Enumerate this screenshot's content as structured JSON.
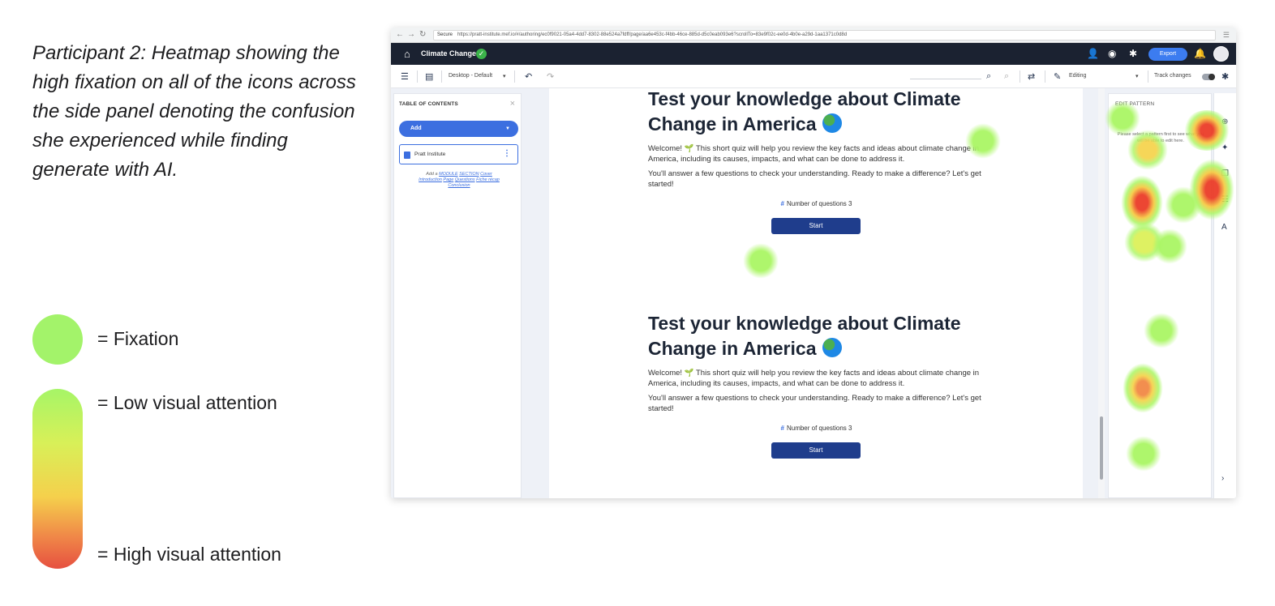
{
  "caption": "Participant 2: Heatmap showing the high fixation on all of the icons across the side panel denoting the confusion she experienced while finding generate with AI.",
  "legend": {
    "fixation": "= Fixation",
    "low": "= Low visual attention",
    "high": "= High visual attention",
    "colors": {
      "fixation": "#a3f36a",
      "low": "#a6f567",
      "mid": "#f5d04c",
      "high": "#e65040"
    }
  },
  "browser": {
    "secure_label": "Secure",
    "url": "https://pratt-institute.mef.io/#/authoring/ec0f9021-05a4-4dd7-8302-88e524a7fdff/page/aa6e453c-f4bb-46ce-885d-d5c0eab093e6?scrollTo=83e9f02c-ee0d-4b0e-a29d-1aa1371c0d8d"
  },
  "app": {
    "title": "Climate Change",
    "export_label": "Export",
    "icons": [
      "home-icon",
      "check-icon",
      "add-user-icon",
      "eye-icon",
      "gear-icon",
      "bell-icon"
    ]
  },
  "toolbar": {
    "device": "Desktop - Default",
    "mode": "Editing",
    "track_changes": "Track changes"
  },
  "toc": {
    "heading": "TABLE OF CONTENTS",
    "add_label": "Add",
    "item_label": "Pratt Institute",
    "links": [
      "Add a",
      "MODULE",
      "SECTION",
      "Cover",
      "Introduction",
      "Page",
      "Questions",
      "Fiche récap",
      "Conclusion"
    ]
  },
  "quiz": {
    "title": "Test your knowledge about Climate Change in America",
    "welcome": "Welcome! 🌱 This short quiz will help you review the key facts and ideas about climate change in America, including its causes, impacts, and what can be done to address it.",
    "answer": "You'll answer a few questions to check your understanding. Ready to make a difference? Let's get started!",
    "count": "Number of questions 3",
    "start": "Start"
  },
  "right_panel": {
    "heading": "EDIT PATTERN",
    "text": "Please select a pattern first to see what you will be able to edit here."
  }
}
